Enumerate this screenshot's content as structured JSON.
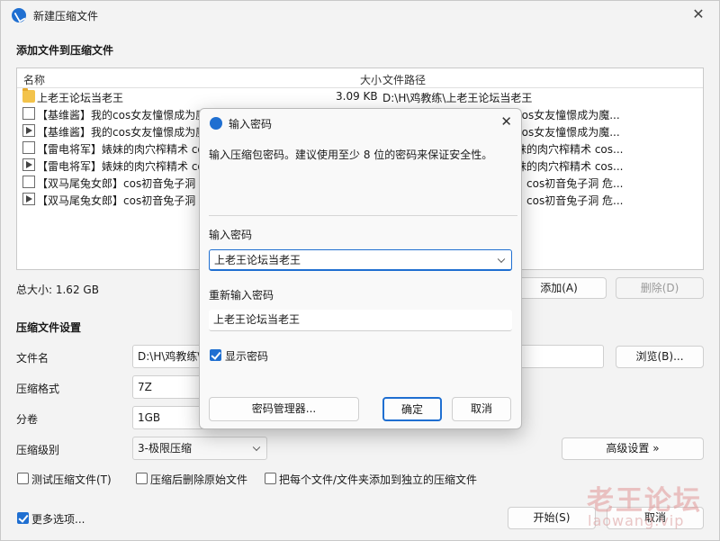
{
  "window": {
    "title": "新建压缩文件"
  },
  "file_section": {
    "title": "添加文件到压缩文件",
    "columns": {
      "name": "名称",
      "size": "大小",
      "path": "文件路径"
    },
    "rows": [
      {
        "name": "上老王论坛当老王",
        "size": "3.09 KB",
        "path": "D:\\H\\鸡教练\\上老王论坛当老王",
        "icon": "folder-icon"
      },
      {
        "name": "【基维酱】我的cos女友憧憬成为魔",
        "size": "",
        "path": "cos女友憧憬成为魔...",
        "icon": "document-icon"
      },
      {
        "name": "【基维酱】我的cos女友憧憬成为魔",
        "size": "",
        "path": "cos女友憧憬成为魔...",
        "icon": "video-icon"
      },
      {
        "name": "【雷电将军】婊妹的肉穴榨精术 co",
        "size": "",
        "path": "妹的肉穴榨精术 cos...",
        "icon": "document-icon"
      },
      {
        "name": "【雷电将军】婊妹的肉穴榨精术 co",
        "size": "",
        "path": "妹的肉穴榨精术 cos...",
        "icon": "video-icon"
      },
      {
        "name": "【双马尾兔女郎】cos初音兔子洞 危",
        "size": "",
        "path": "】cos初音兔子洞 危...",
        "icon": "document-icon"
      },
      {
        "name": "【双马尾兔女郎】cos初音兔子洞 危",
        "size": "",
        "path": "】cos初音兔子洞 危...",
        "icon": "video-icon"
      }
    ],
    "total_size": "总大小: 1.62 GB",
    "add_label": "添加(A)",
    "delete_label": "删除(D)"
  },
  "settings": {
    "title": "压缩文件设置",
    "filename_label": "文件名",
    "filename_value": "D:\\H\\鸡教练\\",
    "browse_label": "浏览(B)...",
    "format_label": "压缩格式",
    "format_value": "7Z",
    "split_label": "分卷",
    "split_value": "1GB",
    "level_label": "压缩级别",
    "level_value": "3-极限压缩",
    "advanced_label": "高级设置 »",
    "check_test": "测试压缩文件(T)",
    "check_delete": "压缩后删除原始文件",
    "check_each": "把每个文件/文件夹添加到独立的压缩文件",
    "more_options": "更多选项...",
    "start_label": "开始(S)",
    "cancel_label": "取消"
  },
  "dialog": {
    "title": "输入密码",
    "hint": "输入压缩包密码。建议使用至少 8 位的密码来保证安全性。",
    "password_label": "输入密码",
    "password_value": "上老王论坛当老王",
    "reenter_label": "重新输入密码",
    "reenter_value": "上老王论坛当老王",
    "show_password": "显示密码",
    "manager_label": "密码管理器...",
    "ok_label": "确定",
    "cancel_label": "取消"
  },
  "watermark": {
    "line1": "老王论坛",
    "line2": "laowang.vip"
  }
}
